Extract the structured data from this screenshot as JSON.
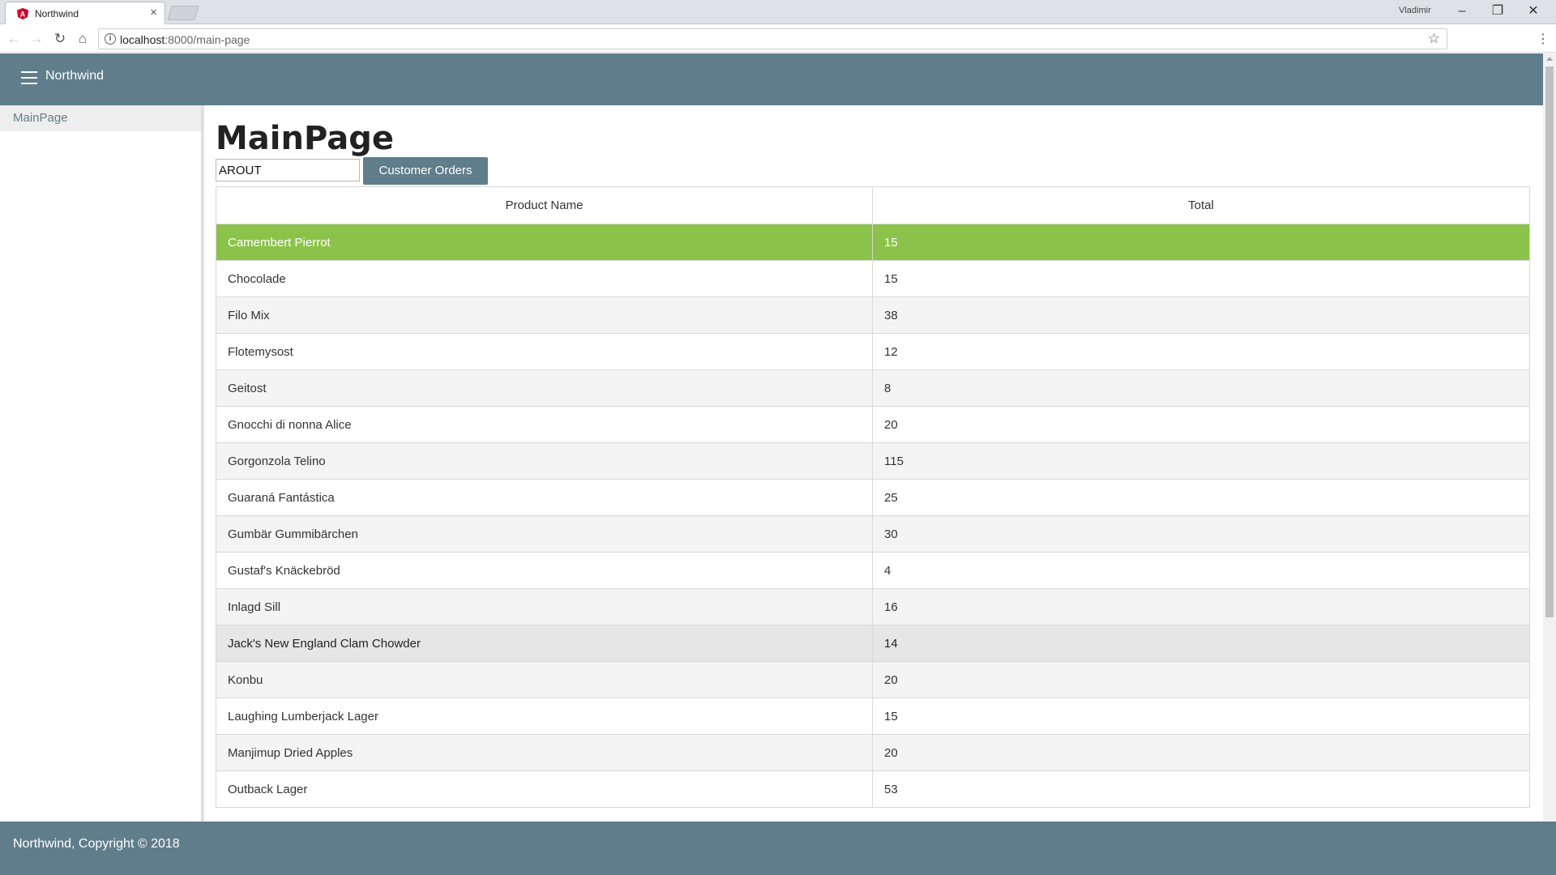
{
  "browser": {
    "tab_title": "Northwind",
    "tab_close": "×",
    "user": "Vladimir",
    "window_controls": {
      "minimize": "–",
      "restore": "❐",
      "close": "✕"
    },
    "url_host": "localhost",
    "url_path": ":8000/main-page",
    "nav": {
      "back": "←",
      "forward": "→",
      "reload": "↻",
      "home": "⌂"
    },
    "info_glyph": "i",
    "star_glyph": "☆",
    "menu_glyph": "⋮"
  },
  "header": {
    "brand": "Northwind"
  },
  "sidebar": {
    "items": [
      {
        "label": "MainPage"
      }
    ]
  },
  "main": {
    "title": "MainPage",
    "customer_input": {
      "value": "AROUT"
    },
    "orders_button": "Customer Orders",
    "table": {
      "columns": [
        "Product Name",
        "Total"
      ],
      "rows": [
        {
          "product": "Camembert Pierrot",
          "total": "15"
        },
        {
          "product": "Chocolade",
          "total": "15"
        },
        {
          "product": "Filo Mix",
          "total": "38"
        },
        {
          "product": "Flotemysost",
          "total": "12"
        },
        {
          "product": "Geitost",
          "total": "8"
        },
        {
          "product": "Gnocchi di nonna Alice",
          "total": "20"
        },
        {
          "product": "Gorgonzola Telino",
          "total": "115"
        },
        {
          "product": "Guaraná Fantástica",
          "total": "25"
        },
        {
          "product": "Gumbär Gummibärchen",
          "total": "30"
        },
        {
          "product": "Gustaf's Knäckebröd",
          "total": "4"
        },
        {
          "product": "Inlagd Sill",
          "total": "16"
        },
        {
          "product": "Jack's New England Clam Chowder",
          "total": "14"
        },
        {
          "product": "Konbu",
          "total": "20"
        },
        {
          "product": "Laughing Lumberjack Lager",
          "total": "15"
        },
        {
          "product": "Manjimup Dried Apples",
          "total": "20"
        },
        {
          "product": "Outback Lager",
          "total": "53"
        }
      ]
    }
  },
  "footer": {
    "text": "Northwind, Copyright © 2018"
  },
  "colors": {
    "primary": "#607d8b",
    "selected_row": "#8bc34a",
    "odd_row": "#f4f4f4"
  }
}
